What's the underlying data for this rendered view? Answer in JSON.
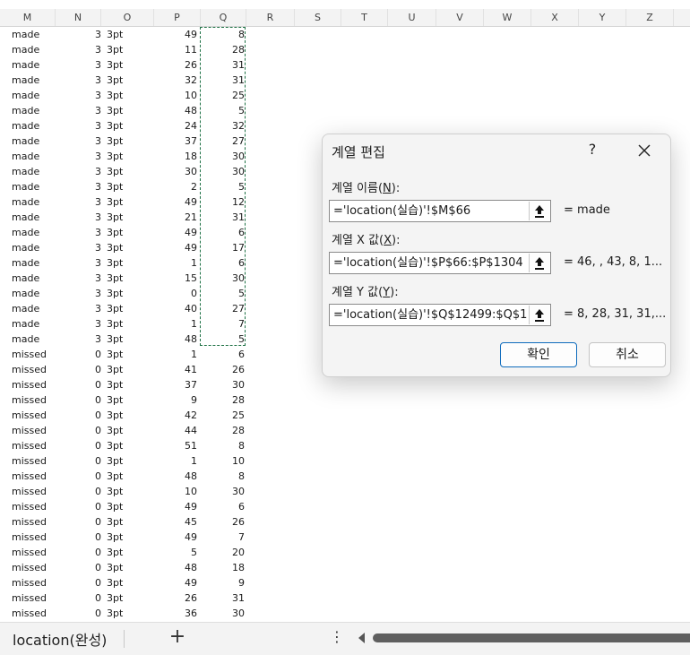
{
  "columns": [
    "M",
    "N",
    "O",
    "P",
    "Q",
    "R",
    "S",
    "T",
    "U",
    "V",
    "W",
    "X",
    "Y",
    "Z"
  ],
  "rows": [
    {
      "m": "made",
      "n": "3",
      "o": "3pt",
      "p": "49",
      "q": "8"
    },
    {
      "m": "made",
      "n": "3",
      "o": "3pt",
      "p": "11",
      "q": "28"
    },
    {
      "m": "made",
      "n": "3",
      "o": "3pt",
      "p": "26",
      "q": "31"
    },
    {
      "m": "made",
      "n": "3",
      "o": "3pt",
      "p": "32",
      "q": "31"
    },
    {
      "m": "made",
      "n": "3",
      "o": "3pt",
      "p": "10",
      "q": "25"
    },
    {
      "m": "made",
      "n": "3",
      "o": "3pt",
      "p": "48",
      "q": "5"
    },
    {
      "m": "made",
      "n": "3",
      "o": "3pt",
      "p": "24",
      "q": "32"
    },
    {
      "m": "made",
      "n": "3",
      "o": "3pt",
      "p": "37",
      "q": "27"
    },
    {
      "m": "made",
      "n": "3",
      "o": "3pt",
      "p": "18",
      "q": "30"
    },
    {
      "m": "made",
      "n": "3",
      "o": "3pt",
      "p": "30",
      "q": "30"
    },
    {
      "m": "made",
      "n": "3",
      "o": "3pt",
      "p": "2",
      "q": "5"
    },
    {
      "m": "made",
      "n": "3",
      "o": "3pt",
      "p": "49",
      "q": "12"
    },
    {
      "m": "made",
      "n": "3",
      "o": "3pt",
      "p": "21",
      "q": "31"
    },
    {
      "m": "made",
      "n": "3",
      "o": "3pt",
      "p": "49",
      "q": "6"
    },
    {
      "m": "made",
      "n": "3",
      "o": "3pt",
      "p": "49",
      "q": "17"
    },
    {
      "m": "made",
      "n": "3",
      "o": "3pt",
      "p": "1",
      "q": "6"
    },
    {
      "m": "made",
      "n": "3",
      "o": "3pt",
      "p": "15",
      "q": "30"
    },
    {
      "m": "made",
      "n": "3",
      "o": "3pt",
      "p": "0",
      "q": "5"
    },
    {
      "m": "made",
      "n": "3",
      "o": "3pt",
      "p": "40",
      "q": "27"
    },
    {
      "m": "made",
      "n": "3",
      "o": "3pt",
      "p": "1",
      "q": "7"
    },
    {
      "m": "made",
      "n": "3",
      "o": "3pt",
      "p": "48",
      "q": "5"
    },
    {
      "m": "missed",
      "n": "0",
      "o": "3pt",
      "p": "1",
      "q": "6"
    },
    {
      "m": "missed",
      "n": "0",
      "o": "3pt",
      "p": "41",
      "q": "26"
    },
    {
      "m": "missed",
      "n": "0",
      "o": "3pt",
      "p": "37",
      "q": "30"
    },
    {
      "m": "missed",
      "n": "0",
      "o": "3pt",
      "p": "9",
      "q": "28"
    },
    {
      "m": "missed",
      "n": "0",
      "o": "3pt",
      "p": "42",
      "q": "25"
    },
    {
      "m": "missed",
      "n": "0",
      "o": "3pt",
      "p": "44",
      "q": "28"
    },
    {
      "m": "missed",
      "n": "0",
      "o": "3pt",
      "p": "51",
      "q": "8"
    },
    {
      "m": "missed",
      "n": "0",
      "o": "3pt",
      "p": "1",
      "q": "10"
    },
    {
      "m": "missed",
      "n": "0",
      "o": "3pt",
      "p": "48",
      "q": "8"
    },
    {
      "m": "missed",
      "n": "0",
      "o": "3pt",
      "p": "10",
      "q": "30"
    },
    {
      "m": "missed",
      "n": "0",
      "o": "3pt",
      "p": "49",
      "q": "6"
    },
    {
      "m": "missed",
      "n": "0",
      "o": "3pt",
      "p": "45",
      "q": "26"
    },
    {
      "m": "missed",
      "n": "0",
      "o": "3pt",
      "p": "49",
      "q": "7"
    },
    {
      "m": "missed",
      "n": "0",
      "o": "3pt",
      "p": "5",
      "q": "20"
    },
    {
      "m": "missed",
      "n": "0",
      "o": "3pt",
      "p": "48",
      "q": "18"
    },
    {
      "m": "missed",
      "n": "0",
      "o": "3pt",
      "p": "49",
      "q": "9"
    },
    {
      "m": "missed",
      "n": "0",
      "o": "3pt",
      "p": "26",
      "q": "31"
    },
    {
      "m": "missed",
      "n": "0",
      "o": "3pt",
      "p": "36",
      "q": "30"
    }
  ],
  "dialog": {
    "title": "계열 편집",
    "help": "?",
    "name_label_prefix": "계열 이름(",
    "name_label_key": "N",
    "name_label_suffix": "):",
    "name_value": "='location(실습)'!$M$66",
    "name_preview": "= made",
    "x_label_prefix": "계열 X 값(",
    "x_label_key": "X",
    "x_label_suffix": "):",
    "x_value": "='location(실습)'!$P$66:$P$1304",
    "x_preview": "= 46, , 43, 8, 1...",
    "y_label_prefix": "계열 Y 값(",
    "y_label_key": "Y",
    "y_label_suffix": "):",
    "y_value": "='location(실습)'!$Q$12499:$Q$1",
    "y_preview": "= 8, 28, 31, 31,...",
    "ok": "확인",
    "cancel": "취소"
  },
  "footer": {
    "sheet_tab": "location(완성)",
    "add": "+",
    "more": "⋮"
  },
  "colors": {
    "selection": "#1e7145",
    "accent": "#0f6cbd"
  }
}
